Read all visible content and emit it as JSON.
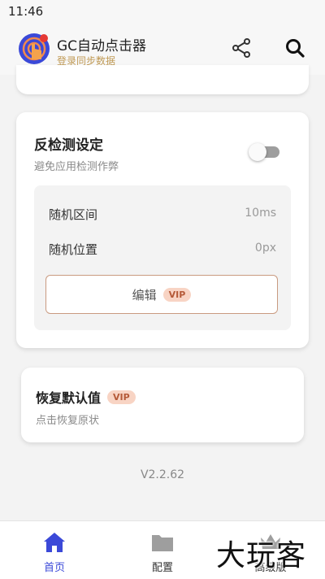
{
  "status_bar": {
    "time": "11:46"
  },
  "header": {
    "title": "GC自动点击器",
    "subtitle": "登录同步数据",
    "share_icon": "share-icon",
    "search_icon": "search-icon"
  },
  "anti_detection": {
    "title": "反检测设定",
    "description": "避免应用检测作弊",
    "toggle_on": false,
    "random_interval_label": "随机区间",
    "random_interval_value": "10ms",
    "random_position_label": "随机位置",
    "random_position_value": "0px",
    "edit_label": "编辑",
    "vip_badge": "VIP"
  },
  "restore_defaults": {
    "title": "恢复默认值",
    "vip_badge": "VIP",
    "description": "点击恢复原状"
  },
  "version": "V2.2.62",
  "bottom_nav": {
    "items": [
      {
        "label": "首页",
        "icon": "home-icon",
        "active": true
      },
      {
        "label": "配置",
        "icon": "folder-icon",
        "active": false
      },
      {
        "label": "高级版",
        "icon": "crown-icon",
        "active": false
      }
    ]
  },
  "watermark": "大玩客",
  "colors": {
    "accent": "#3b49d8",
    "vip_bg": "#f8d4c4",
    "vip_text": "#b55a38",
    "subtitle": "#c09a55",
    "edit_border": "#c99a80"
  }
}
